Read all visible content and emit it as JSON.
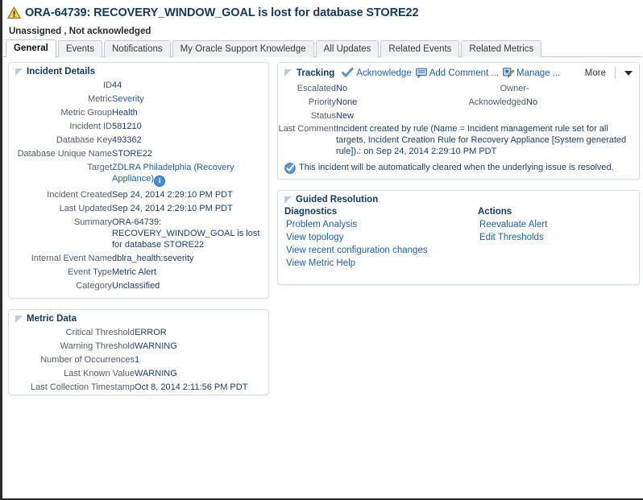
{
  "header": {
    "warning_icon": "warning-triangle-icon",
    "title": "ORA-64739: RECOVERY_WINDOW_GOAL is lost for database STORE22",
    "subtitle": "Unassigned , Not acknowledged"
  },
  "tabs": [
    {
      "label": "General",
      "active": true
    },
    {
      "label": "Events",
      "active": false
    },
    {
      "label": "Notifications",
      "active": false
    },
    {
      "label": "My Oracle Support Knowledge",
      "active": false
    },
    {
      "label": "All Updates",
      "active": false
    },
    {
      "label": "Related Events",
      "active": false
    },
    {
      "label": "Related Metrics",
      "active": false
    }
  ],
  "incident_details": {
    "title": "Incident Details",
    "rows": [
      {
        "label": "ID",
        "value": "44",
        "link": false
      },
      {
        "label": "Metric",
        "value": "Severity",
        "link": true
      },
      {
        "label": "Metric Group",
        "value": "Health",
        "link": false
      },
      {
        "label": "Incident ID",
        "value": "581210",
        "link": false
      },
      {
        "label": "Database Key",
        "value": "493362",
        "link": false
      },
      {
        "label": "Database Unique Name",
        "value": "STORE22",
        "link": false
      },
      {
        "label": "Target",
        "value": "ZDLRA Philadelphia (Recovery Appliance)",
        "link": true,
        "info_icon": "info-icon"
      },
      {
        "label": "Incident Created",
        "value": "Sep 24, 2014 2:29:10 PM PDT",
        "link": false
      },
      {
        "label": "Last Updated",
        "value": "Sep 24, 2014 2:29:10 PM PDT",
        "link": false
      },
      {
        "label": "Summary",
        "value": "ORA-64739: RECOVERY_WINDOW_GOAL is lost for database STORE22",
        "link": false
      },
      {
        "label": "Internal Event Name",
        "value": "dblra_health:severity",
        "link": false
      },
      {
        "label": "Event Type",
        "value": "Metric Alert",
        "link": false
      },
      {
        "label": "Category",
        "value": "Unclassified",
        "link": false
      }
    ]
  },
  "metric_data": {
    "title": "Metric Data",
    "rows": [
      {
        "label": "Critical Threshold",
        "value": "ERROR"
      },
      {
        "label": "Warning Threshold",
        "value": "WARNING"
      },
      {
        "label": "Number of Occurrences",
        "value": "1"
      },
      {
        "label": "Last Known Value",
        "value": "WARNING"
      },
      {
        "label": "Last Collection Timestamp",
        "value": "Oct 8, 2014 2:11:56 PM PDT"
      }
    ]
  },
  "tracking": {
    "title": "Tracking",
    "toolbar": [
      {
        "label": "Acknowledge",
        "icon": "check-mark-icon"
      },
      {
        "label": "Add Comment ...",
        "icon": "comment-bubble-icon"
      },
      {
        "label": "Manage ...",
        "icon": "manage-pencil-icon"
      }
    ],
    "more_label": "More",
    "dropdown_icon": "chevron-down-icon",
    "left_rows": [
      {
        "label": "Escalated",
        "value": "No"
      },
      {
        "label": "Priority",
        "value": "None"
      },
      {
        "label": "Status",
        "value": "New"
      }
    ],
    "right_rows": [
      {
        "label": "Owner",
        "value": "-"
      },
      {
        "label": "Acknowledged",
        "value": "No"
      }
    ],
    "last_comment_label": "Last Comment",
    "last_comment_value": "Incident created by rule (Name = Incident management rule set for all targets, Incident Creation Rule for Recovery Appliance [System generated rule]).: on Sep 24, 2014 2:29:10 PM PDT",
    "auto_clear_icon": "check-badge-icon",
    "auto_clear_note": "This incident will be automatically cleared when the underlying issue is resolved."
  },
  "guided_resolution": {
    "title": "Guided Resolution",
    "diagnostics_heading": "Diagnostics",
    "diagnostics_links": [
      "Problem Analysis",
      "View topology",
      "View recent configuration changes",
      "View Metric Help"
    ],
    "actions_heading": "Actions",
    "actions_links": [
      "Reevaluate Alert",
      "Edit Thresholds"
    ]
  },
  "colors": {
    "title_blue": "#12395f",
    "link_blue": "#1f5fa8",
    "label_gray": "#4d5d6e",
    "panel_border": "#d5dde5",
    "warning_yellow": "#f2c431",
    "accent_blue": "#4a8fd4"
  }
}
